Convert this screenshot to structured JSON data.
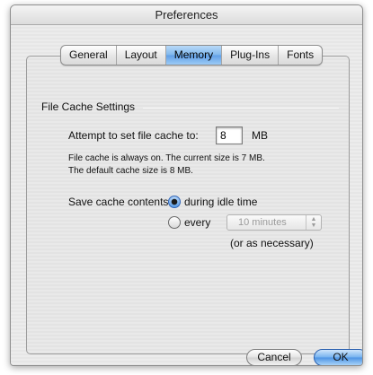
{
  "window": {
    "title": "Preferences"
  },
  "tabs": [
    {
      "label": "General",
      "selected": false
    },
    {
      "label": "Layout",
      "selected": false
    },
    {
      "label": "Memory",
      "selected": true
    },
    {
      "label": "Plug-Ins",
      "selected": false
    },
    {
      "label": "Fonts",
      "selected": false
    }
  ],
  "file_cache": {
    "group_label": "File Cache Settings",
    "attempt_label": "Attempt to set file cache to:",
    "size_value": "8",
    "unit": "MB",
    "info_line1": "File cache is always on.  The current size is 7 MB.",
    "info_line2": "The default cache size is 8 MB.",
    "save_label": "Save cache contents:",
    "option_idle": "during idle time",
    "option_every": "every",
    "interval_value": "10 minutes",
    "note": "(or as necessary)",
    "selected_option": "during idle time"
  },
  "buttons": {
    "cancel": "Cancel",
    "ok": "OK"
  },
  "colors": {
    "selected_tab": "#7fb7ec",
    "default_button": "#4d93e4"
  }
}
